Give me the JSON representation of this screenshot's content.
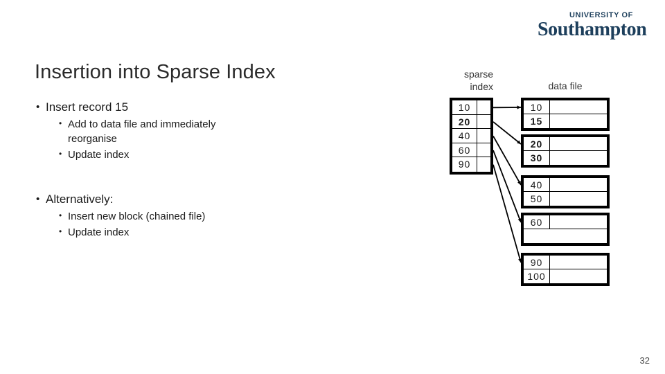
{
  "logo": {
    "line1": "UNIVERSITY OF",
    "line2": "Southampton",
    "color": "#1d3f5c"
  },
  "title": "Insertion into Sparse Index",
  "body": {
    "groups": [
      {
        "heading": "Insert record 15",
        "sub": [
          {
            "line1": "Add to data file and immediately",
            "line2": "reorganise"
          },
          {
            "line1": "Update index",
            "line2": ""
          }
        ]
      },
      {
        "heading": "Alternatively:",
        "sub": [
          {
            "line1": "Insert new block (chained file)",
            "line2": ""
          },
          {
            "line1": "Update index",
            "line2": ""
          }
        ]
      }
    ]
  },
  "diagram": {
    "sparse_index_label_line1": "sparse",
    "sparse_index_label_line2": "index",
    "data_file_label": "data file",
    "highlight_color": "#b21b1b",
    "index_entries": [
      {
        "key": "10",
        "highlight": false
      },
      {
        "key": "20",
        "highlight": true
      },
      {
        "key": "40",
        "highlight": false
      },
      {
        "key": "60",
        "highlight": false
      },
      {
        "key": "90",
        "highlight": false
      }
    ],
    "data_blocks": [
      {
        "records": [
          {
            "key": "10",
            "highlight": false
          },
          {
            "key": "15",
            "highlight": true
          }
        ]
      },
      {
        "records": [
          {
            "key": "20",
            "highlight": true
          },
          {
            "key": "30",
            "highlight": true
          }
        ]
      },
      {
        "records": [
          {
            "key": "40",
            "highlight": false
          },
          {
            "key": "50",
            "highlight": false
          }
        ]
      },
      {
        "records": [
          {
            "key": "60",
            "highlight": false
          },
          {
            "key": "",
            "highlight": false
          }
        ]
      },
      {
        "records": [
          {
            "key": "90",
            "highlight": false
          },
          {
            "key": "100",
            "highlight": false
          }
        ]
      }
    ],
    "pointers": [
      {
        "from_entry": 0,
        "to_block": 0
      },
      {
        "from_entry": 1,
        "to_block": 1
      },
      {
        "from_entry": 2,
        "to_block": 2
      },
      {
        "from_entry": 3,
        "to_block": 3
      },
      {
        "from_entry": 4,
        "to_block": 4
      }
    ]
  },
  "page_number": "32"
}
